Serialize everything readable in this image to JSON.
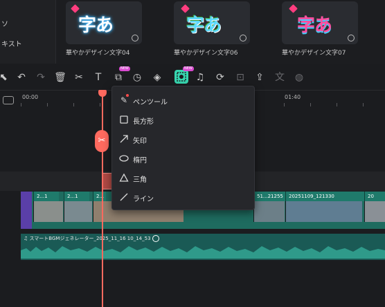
{
  "library": {
    "sidebar": [
      "ソ",
      "キスト"
    ],
    "cards": [
      {
        "caption": "華やかデザイン文字04",
        "art": "字あ"
      },
      {
        "caption": "華やかデザイン文字06",
        "art": "字あ"
      },
      {
        "caption": "華やかデザイン文字07",
        "art": "字あ"
      }
    ]
  },
  "toolbar": {
    "new_badge": "NEW",
    "icons": [
      "select-icon",
      "undo-icon",
      "redo-icon",
      "delete-icon",
      "cut-icon",
      "text-icon",
      "crop-icon",
      "speed-icon",
      "color-icon",
      "mask-icon",
      "audio-icon",
      "ai-icon",
      "keyframe-icon",
      "export-frame-icon",
      "translate-icon",
      "palette-icon"
    ]
  },
  "ruler": {
    "start": "00:00",
    "mark": "01:40"
  },
  "menu": {
    "items": [
      {
        "label": "ペンツール",
        "icon": "pen-tool-icon"
      },
      {
        "label": "長方形",
        "icon": "rectangle-icon"
      },
      {
        "label": "矢印",
        "icon": "arrow-icon"
      },
      {
        "label": "楕円",
        "icon": "ellipse-icon"
      },
      {
        "label": "三角",
        "icon": "triangle-icon"
      },
      {
        "label": "ライン",
        "icon": "line-icon"
      }
    ]
  },
  "video_track": {
    "clips": [
      "2...1",
      "2...1",
      "2...",
      "51...21255",
      "20251109_121330",
      "20"
    ]
  },
  "audio_track": {
    "label": "スマートBGMジェネレーター_2025_11_16 10_14_53"
  },
  "colors": {
    "accent": "#37d6b0",
    "playhead": "#ff6a5f",
    "video": "#1f7a6b",
    "audio": "#1a5a55"
  }
}
